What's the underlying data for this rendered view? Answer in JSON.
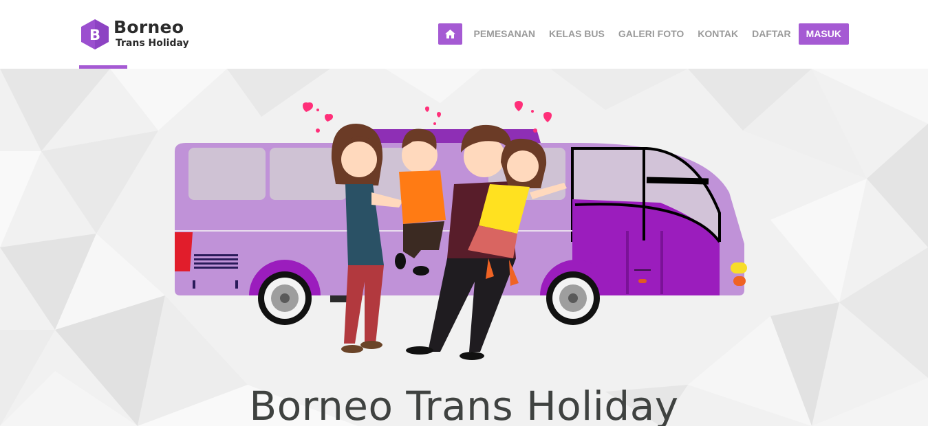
{
  "brand": {
    "logo_letter": "B",
    "name_line1": "Borneo",
    "name_line2": "Trans Holiday",
    "accent_color": "#a55ad3"
  },
  "nav": {
    "home_icon": "home-icon",
    "items": [
      "PEMESANAN",
      "KELAS BUS",
      "GALERI FOTO",
      "KONTAK",
      "DAFTAR"
    ],
    "login_label": "MASUK"
  },
  "hero": {
    "title": "Borneo Trans Holiday",
    "illustration": "family-with-purple-bus"
  }
}
